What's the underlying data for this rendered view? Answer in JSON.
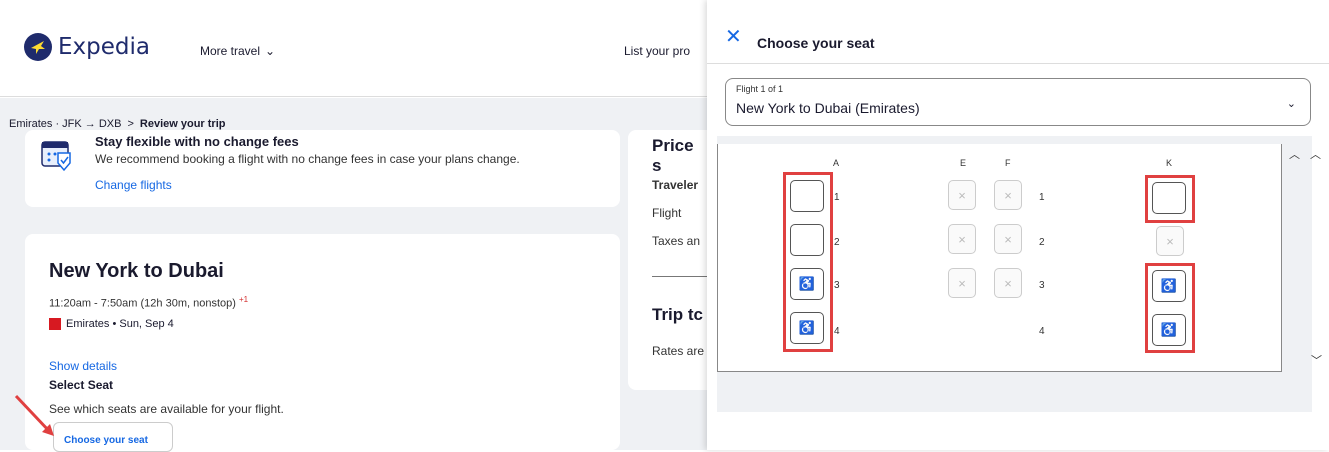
{
  "header": {
    "brand": "Expedia",
    "more_travel": "More travel",
    "list_property": "List your pro"
  },
  "breadcrumb": {
    "route": "Emirates · JFK → DXB",
    "sep": ">",
    "current": "Review your trip"
  },
  "flex_card": {
    "heading": "Stay flexible with no change fees",
    "text": "We recommend booking a flight with no change fees in case your plans change.",
    "link": "Change flights"
  },
  "flight_card": {
    "title": "New York to Dubai",
    "time": "11:20am - 7:50am (12h 30m, nonstop)",
    "next_day": "+1",
    "airline": "Emirates • Sun, Sep 4",
    "show_details": "Show details",
    "select_seat": "Select Seat",
    "see_seats": "See which seats are available for your flight.",
    "choose_btn": "Choose your seat"
  },
  "price": {
    "title": "Price s",
    "rows": [
      "Traveler",
      "Flight",
      "Taxes an"
    ],
    "trip_title": "Trip tc",
    "rates": "Rates are"
  },
  "panel": {
    "title": "Choose your seat",
    "select_label": "Flight 1 of 1",
    "select_value": "New York to Dubai (Emirates)"
  },
  "seatmap": {
    "columns": [
      "A",
      "E",
      "F",
      "K"
    ],
    "rows": [
      "1",
      "2",
      "3",
      "4"
    ],
    "wheelchair": "♿",
    "blocked": "×"
  },
  "colors": {
    "accent": "#1668e3",
    "brand": "#1f2b6c",
    "highlight": "#e04040"
  }
}
